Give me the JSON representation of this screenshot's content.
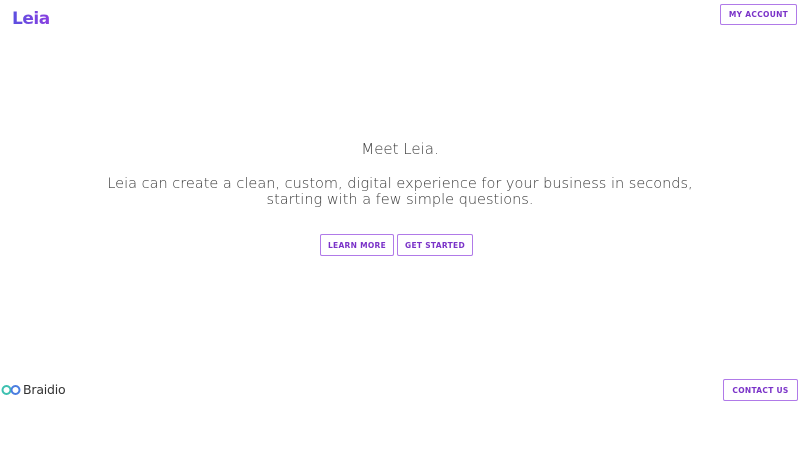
{
  "header": {
    "logo_text": "Leia",
    "account_button": "MY ACCOUNT"
  },
  "hero": {
    "title": "Meet Leia.",
    "subtitle": "Leia can create a clean, custom, digital experience for your business in seconds, starting with a few simple questions.",
    "learn_more_button": "LEARN MORE",
    "get_started_button": "GET STARTED"
  },
  "footer": {
    "brand_text": "Braidio",
    "brand_icon": "braidio-infinity-icon",
    "contact_button": "CONTACT US"
  },
  "colors": {
    "accent": "#7a32c8",
    "button_border": "#b07ae8",
    "logo": "#6a4de0",
    "braidio_icon": "#3cc0b0",
    "text": "#3a3a3a"
  }
}
